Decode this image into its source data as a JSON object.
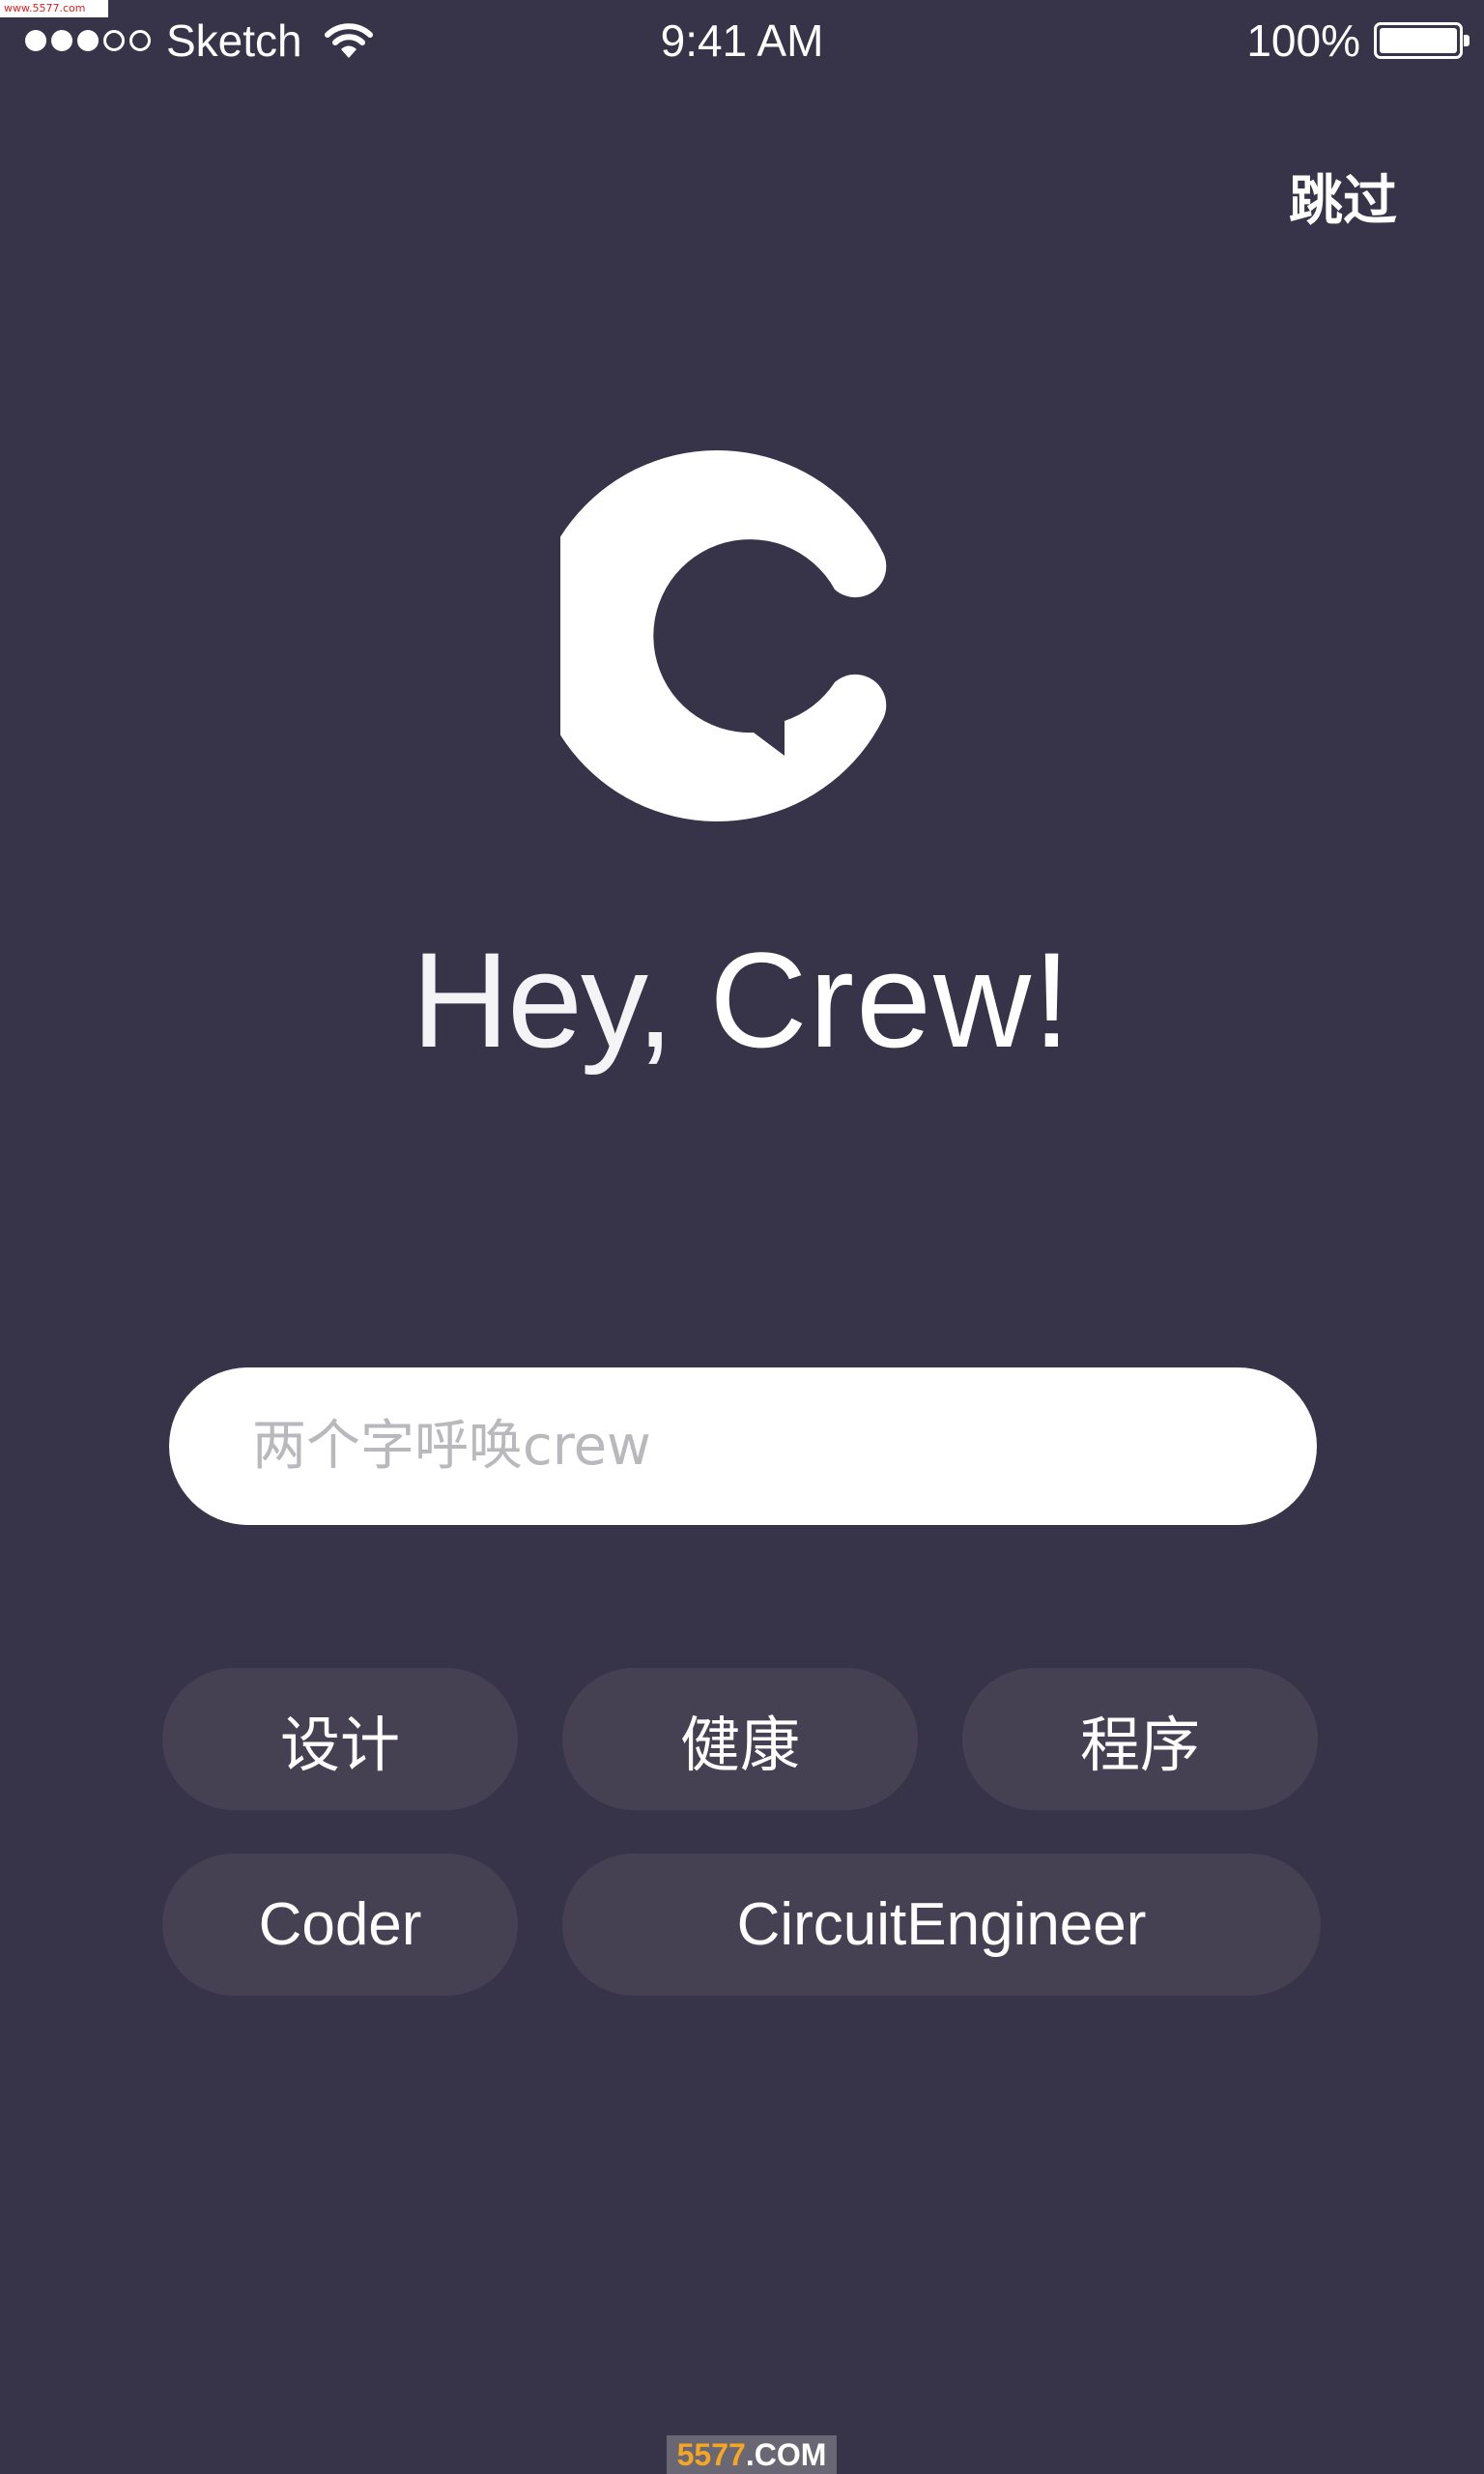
{
  "watermark_top": "www.5577.com",
  "status_bar": {
    "carrier": "Sketch",
    "time": "9:41 AM",
    "battery_percent": "100%",
    "signal_bars_filled": 3,
    "signal_bars_total": 5,
    "battery_level": 1.0
  },
  "header": {
    "skip_label": "跳过"
  },
  "logo": {
    "icon": "crew-logo-icon",
    "color": "#ffffff"
  },
  "greeting": {
    "part1": "Hey,",
    "part2": "Crew!"
  },
  "search": {
    "value": "",
    "placeholder": "两个字呼唤crew"
  },
  "tags": [
    {
      "label": "设计"
    },
    {
      "label": "健康"
    },
    {
      "label": "程序"
    },
    {
      "label": "Coder"
    },
    {
      "label": "CircuitEngineer"
    }
  ],
  "watermark_bottom": {
    "number": "5577",
    "domain": ".COM"
  },
  "colors": {
    "background": "#37344a",
    "tag_background": "#454152",
    "input_background": "#ffffff",
    "placeholder": "#b8b8bd"
  }
}
